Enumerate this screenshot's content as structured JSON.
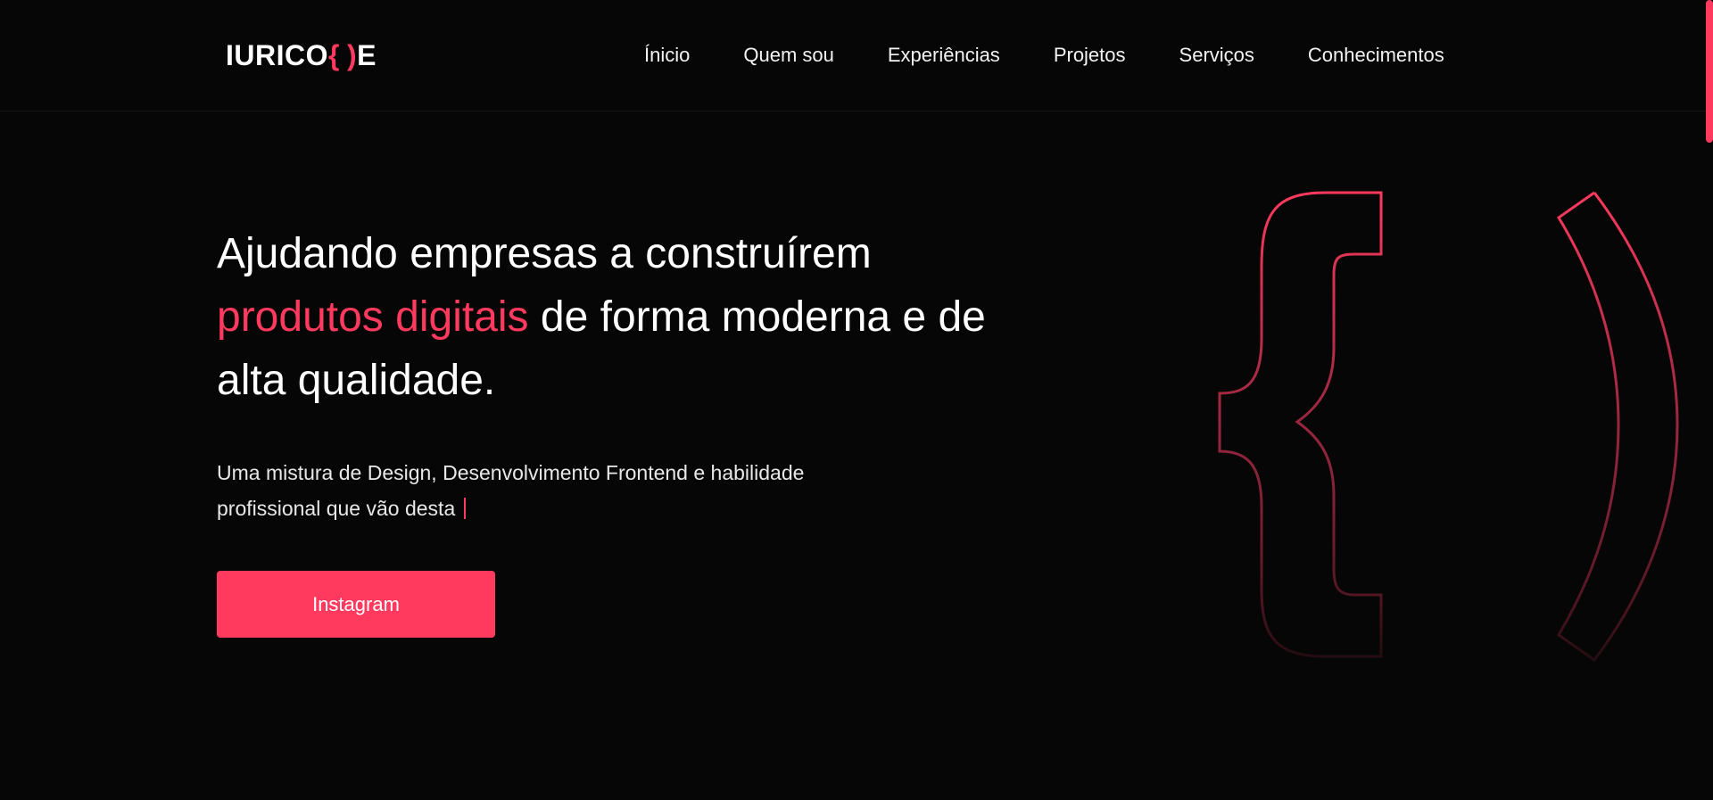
{
  "header": {
    "logo": {
      "prefix": "IURICO",
      "brace_left": "{",
      "brace_right": ")",
      "suffix": "E"
    },
    "nav": [
      {
        "label": "Ínicio"
      },
      {
        "label": "Quem sou"
      },
      {
        "label": "Experiências"
      },
      {
        "label": "Projetos"
      },
      {
        "label": "Serviços"
      },
      {
        "label": "Conhecimentos"
      }
    ]
  },
  "hero": {
    "headline_part1": "Ajudando empresas a construírem",
    "headline_highlight": "produtos digitais",
    "headline_part2": " de forma moderna e de alta qualidade.",
    "lead": "Uma mistura de Design, Desenvolvimento Frontend e habilidade profissional que vão desta",
    "cta_label": "Instagram"
  },
  "colors": {
    "background": "#060607",
    "accent": "#ff3a5e",
    "text": "#ffffff"
  },
  "icons": {
    "hero_art": "brace-paren-outline-icon"
  }
}
